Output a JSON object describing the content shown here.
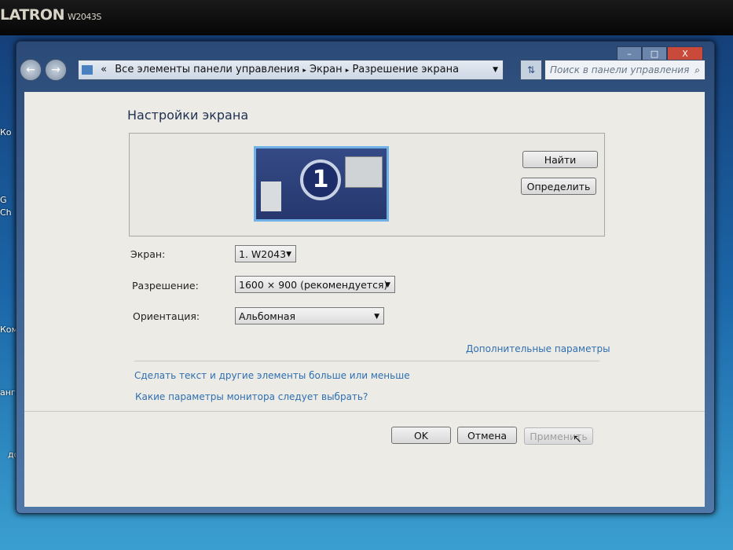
{
  "monitor_bezel": {
    "brand": "LATRON",
    "model": "W2043S"
  },
  "desktop": {
    "icon_labels": [
      "Ко",
      "G",
      "Ch",
      "Ком",
      "англ",
      "док",
      "к"
    ]
  },
  "window": {
    "controls": {
      "minimize": "–",
      "maximize": "□",
      "close": "X"
    },
    "nav": {
      "back": "←",
      "forward": "→"
    },
    "breadcrumb": {
      "overflow": "«",
      "items": [
        "Все элементы панели управления",
        "Экран",
        "Разрешение экрана"
      ],
      "separator": "▸"
    },
    "search": {
      "placeholder": "Поиск в панели управления"
    }
  },
  "main": {
    "title": "Настройки экрана",
    "monitor_number": "1",
    "find_button": "Найти",
    "identify_button": "Определить",
    "fields": [
      {
        "label": "Экран:",
        "value": "1. W2043"
      },
      {
        "label": "Разрешение:",
        "value": "1600 × 900 (рекомендуется)"
      },
      {
        "label": "Ориентация:",
        "value": "Альбомная"
      }
    ],
    "advanced_link": "Дополнительные параметры",
    "links": [
      "Сделать текст и другие элементы больше или меньше",
      "Какие параметры монитора следует выбрать?"
    ],
    "buttons": {
      "ok": "OK",
      "cancel": "Отмена",
      "apply": "Применить"
    },
    "apply_enabled": false
  }
}
